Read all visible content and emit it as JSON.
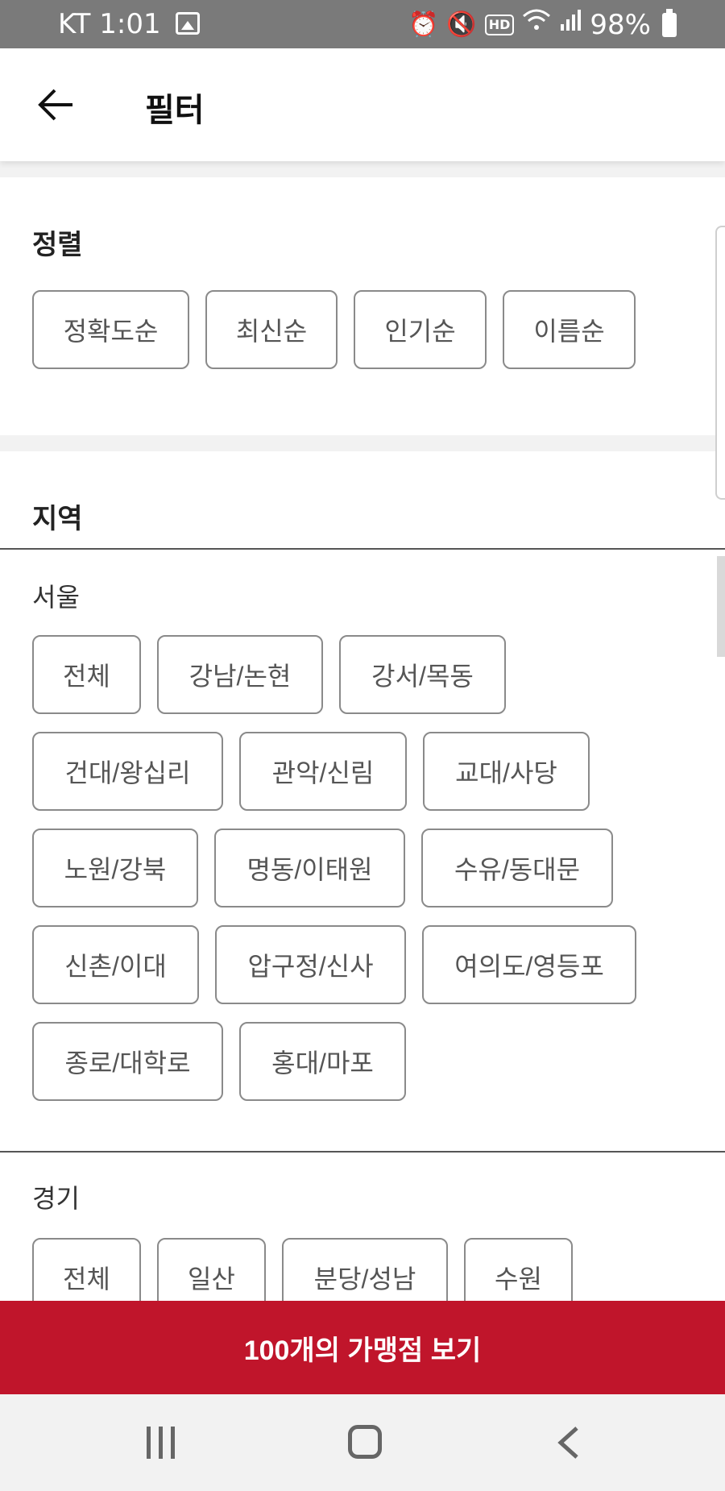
{
  "status_bar": {
    "carrier_time": "KT 1:01",
    "battery": "98%"
  },
  "header": {
    "title": "필터"
  },
  "sort": {
    "title": "정렬",
    "options": [
      "정확도순",
      "최신순",
      "인기순",
      "이름순"
    ]
  },
  "region": {
    "title": "지역",
    "seoul": {
      "title": "서울",
      "options": [
        "전체",
        "강남/논현",
        "강서/목동",
        "건대/왕십리",
        "관악/신림",
        "교대/사당",
        "노원/강북",
        "명동/이태원",
        "수유/동대문",
        "신촌/이대",
        "압구정/신사",
        "여의도/영등포",
        "종로/대학로",
        "홍대/마포"
      ]
    },
    "gyeonggi": {
      "title": "경기",
      "options": [
        "전체",
        "일산",
        "분당/성남",
        "수원"
      ]
    }
  },
  "cta": {
    "label": "100개의 가맹점 보기"
  },
  "colors": {
    "accent": "#c0152b",
    "chip_border": "#8a8a8a"
  }
}
